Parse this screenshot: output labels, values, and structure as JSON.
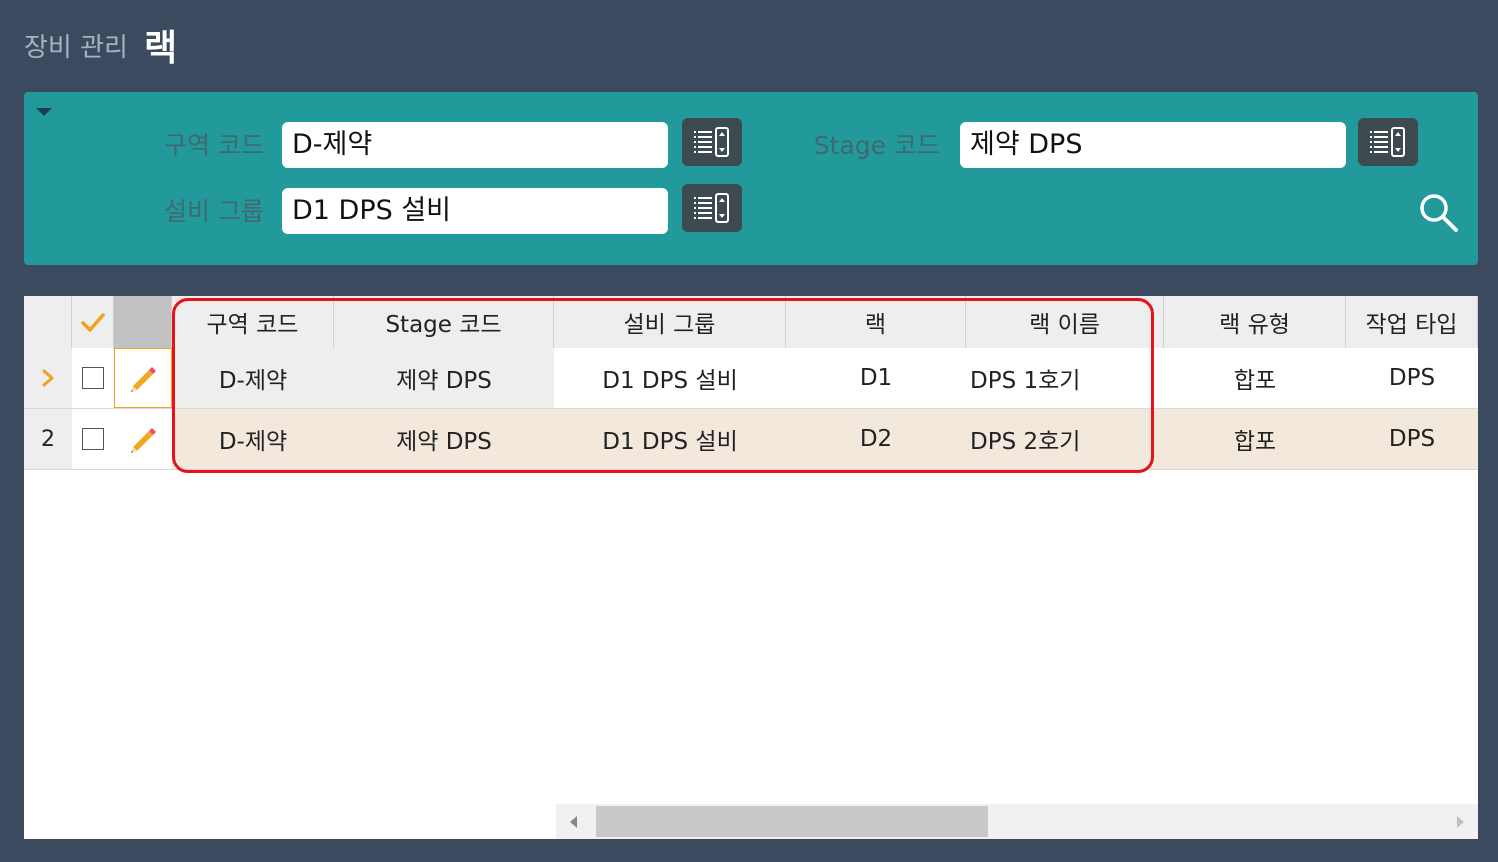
{
  "header": {
    "breadcrumb": "장비 관리",
    "title": "랙"
  },
  "search": {
    "fields": [
      {
        "label": "구역 코드",
        "value": "D-제약"
      },
      {
        "label": "Stage 코드",
        "value": "제약 DPS"
      },
      {
        "label": "설비 그룹",
        "value": "D1 DPS 설비"
      }
    ]
  },
  "grid": {
    "columns": [
      "구역 코드",
      "Stage 코드",
      "설비 그룹",
      "랙",
      "랙 이름",
      "랙 유형",
      "작업 타입"
    ],
    "rows": [
      {
        "indicator": "›",
        "cells": [
          "D-제약",
          "제약 DPS",
          "D1 DPS 설비",
          "D1",
          "DPS 1호기",
          "합포",
          "DPS"
        ]
      },
      {
        "indicator": "2",
        "cells": [
          "D-제약",
          "제약 DPS",
          "D1 DPS 설비",
          "D2",
          "DPS 2호기",
          "합포",
          "DPS"
        ]
      }
    ]
  },
  "colors": {
    "panel": "#22999a",
    "background": "#3c4a5f",
    "highlight": "#e8121b",
    "selected_row": "#f2e9dc"
  },
  "icons": [
    "list-icon",
    "search-icon",
    "check-icon",
    "pencil-icon",
    "chevron-right-icon"
  ]
}
